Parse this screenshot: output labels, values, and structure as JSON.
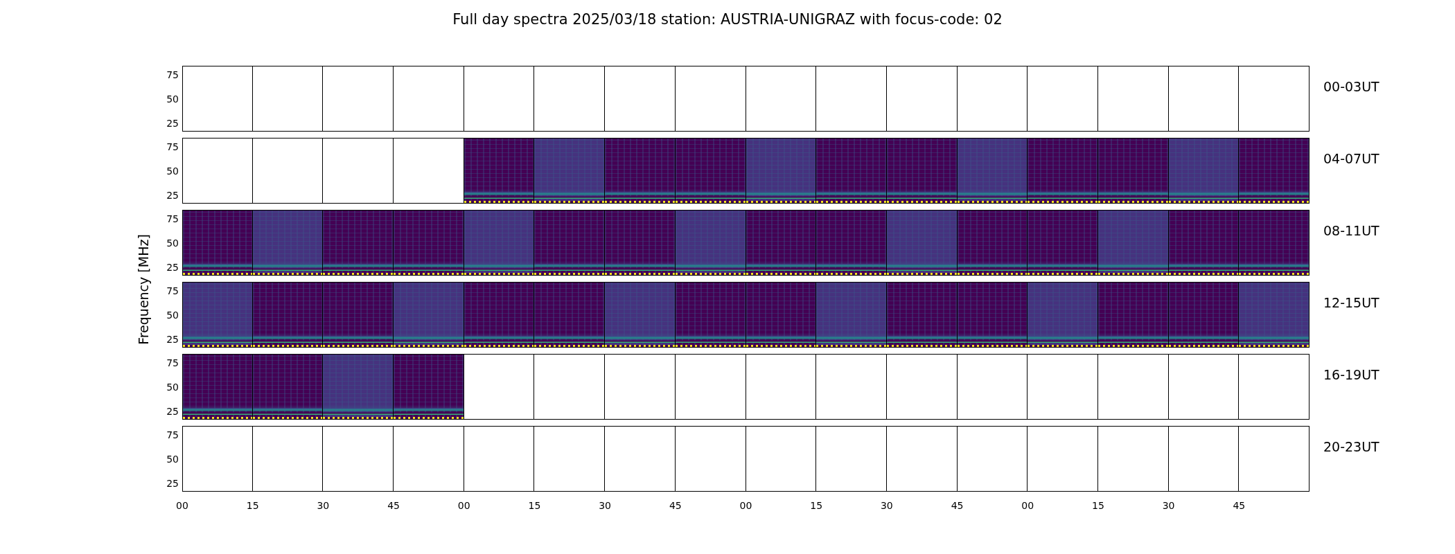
{
  "title": "Full day spectra 2025/03/18 station: AUSTRIA-UNIGRAZ with focus-code: 02",
  "ylabel": "Frequency [MHz]",
  "rows": [
    {
      "label": "00-03UT",
      "yticks": [
        "75",
        "50",
        "25"
      ],
      "panels": [
        {
          "kind": "empty"
        },
        {
          "kind": "empty"
        },
        {
          "kind": "empty"
        },
        {
          "kind": "empty"
        },
        {
          "kind": "empty"
        },
        {
          "kind": "empty"
        },
        {
          "kind": "empty"
        },
        {
          "kind": "empty"
        },
        {
          "kind": "empty"
        },
        {
          "kind": "empty"
        },
        {
          "kind": "empty"
        },
        {
          "kind": "empty"
        },
        {
          "kind": "empty"
        },
        {
          "kind": "empty"
        },
        {
          "kind": "empty"
        },
        {
          "kind": "empty"
        }
      ]
    },
    {
      "label": "04-07UT",
      "yticks": [
        "75",
        "50",
        "25"
      ],
      "panels": [
        {
          "kind": "empty"
        },
        {
          "kind": "empty"
        },
        {
          "kind": "empty"
        },
        {
          "kind": "empty"
        },
        {
          "kind": "spectrum"
        },
        {
          "kind": "spectrum"
        },
        {
          "kind": "spectrum"
        },
        {
          "kind": "spectrum"
        },
        {
          "kind": "spectrum"
        },
        {
          "kind": "spectrum"
        },
        {
          "kind": "spectrum"
        },
        {
          "kind": "spectrum"
        },
        {
          "kind": "spectrum"
        },
        {
          "kind": "spectrum"
        },
        {
          "kind": "spectrum"
        },
        {
          "kind": "spectrum"
        }
      ]
    },
    {
      "label": "08-11UT",
      "yticks": [
        "75",
        "50",
        "25"
      ],
      "panels": [
        {
          "kind": "spectrum"
        },
        {
          "kind": "spectrum"
        },
        {
          "kind": "spectrum"
        },
        {
          "kind": "spectrum"
        },
        {
          "kind": "spectrum"
        },
        {
          "kind": "spectrum"
        },
        {
          "kind": "spectrum"
        },
        {
          "kind": "spectrum"
        },
        {
          "kind": "spectrum"
        },
        {
          "kind": "spectrum"
        },
        {
          "kind": "spectrum"
        },
        {
          "kind": "spectrum"
        },
        {
          "kind": "spectrum"
        },
        {
          "kind": "spectrum"
        },
        {
          "kind": "spectrum"
        },
        {
          "kind": "spectrum"
        }
      ]
    },
    {
      "label": "12-15UT",
      "yticks": [
        "75",
        "50",
        "25"
      ],
      "panels": [
        {
          "kind": "spectrum"
        },
        {
          "kind": "spectrum"
        },
        {
          "kind": "spectrum"
        },
        {
          "kind": "spectrum"
        },
        {
          "kind": "spectrum"
        },
        {
          "kind": "spectrum"
        },
        {
          "kind": "spectrum"
        },
        {
          "kind": "spectrum"
        },
        {
          "kind": "spectrum"
        },
        {
          "kind": "spectrum"
        },
        {
          "kind": "spectrum"
        },
        {
          "kind": "spectrum"
        },
        {
          "kind": "spectrum"
        },
        {
          "kind": "spectrum"
        },
        {
          "kind": "spectrum"
        },
        {
          "kind": "spectrum"
        }
      ]
    },
    {
      "label": "16-19UT",
      "yticks": [
        "75",
        "50",
        "25"
      ],
      "panels": [
        {
          "kind": "spectrum"
        },
        {
          "kind": "spectrum"
        },
        {
          "kind": "spectrum"
        },
        {
          "kind": "spectrum"
        },
        {
          "kind": "empty"
        },
        {
          "kind": "empty"
        },
        {
          "kind": "empty"
        },
        {
          "kind": "empty"
        },
        {
          "kind": "empty"
        },
        {
          "kind": "empty"
        },
        {
          "kind": "empty"
        },
        {
          "kind": "empty"
        },
        {
          "kind": "empty"
        },
        {
          "kind": "empty"
        },
        {
          "kind": "empty"
        },
        {
          "kind": "empty"
        }
      ]
    },
    {
      "label": "20-23UT",
      "yticks": [
        "75",
        "50",
        "25"
      ],
      "panels": [
        {
          "kind": "empty"
        },
        {
          "kind": "empty"
        },
        {
          "kind": "empty"
        },
        {
          "kind": "empty"
        },
        {
          "kind": "empty"
        },
        {
          "kind": "empty"
        },
        {
          "kind": "empty"
        },
        {
          "kind": "empty"
        },
        {
          "kind": "empty"
        },
        {
          "kind": "empty"
        },
        {
          "kind": "empty"
        },
        {
          "kind": "empty"
        },
        {
          "kind": "empty"
        },
        {
          "kind": "empty"
        },
        {
          "kind": "empty"
        },
        {
          "kind": "empty"
        }
      ]
    }
  ],
  "xticks": [
    "00",
    "15",
    "30",
    "45",
    "00",
    "15",
    "30",
    "45",
    "00",
    "15",
    "30",
    "45",
    "00",
    "15",
    "30",
    "45"
  ]
}
